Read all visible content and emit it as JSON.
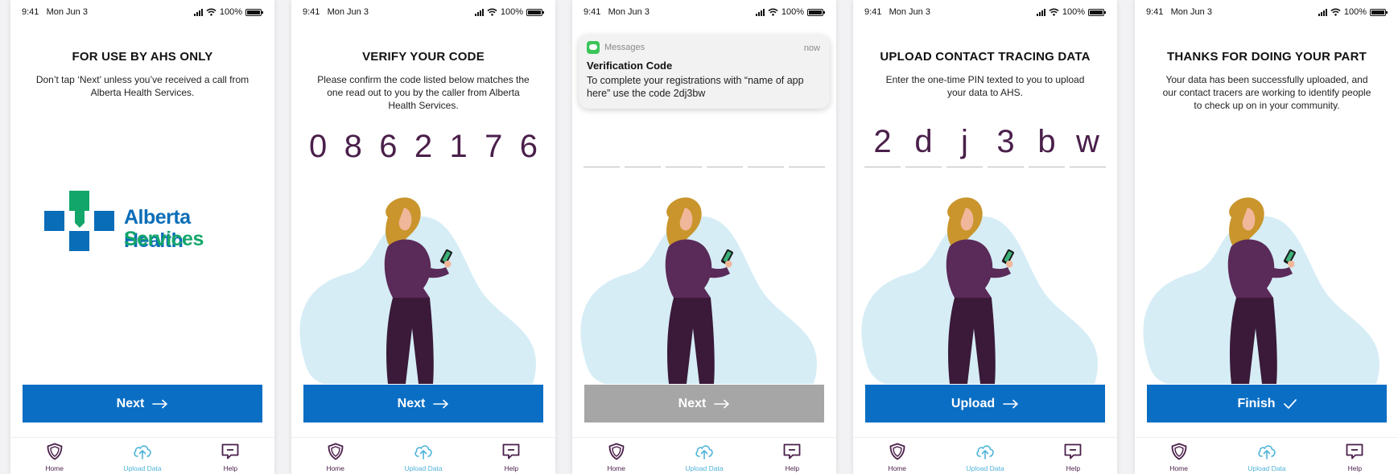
{
  "status": {
    "time": "9:41",
    "date": "Mon Jun 3",
    "battery": "100%"
  },
  "tabs": [
    {
      "label": "Home",
      "icon": "shield-icon"
    },
    {
      "label": "Upload Data",
      "icon": "cloud-upload-icon"
    },
    {
      "label": "Help",
      "icon": "chat-bubble-icon"
    }
  ],
  "screens": [
    {
      "title": "FOR USE BY AHS ONLY",
      "body": "Don’t tap ‘Next’ unless you’ve received a call from Alberta Health Services.",
      "logo": {
        "line1": "Alberta Health",
        "line2": "Services"
      },
      "button": "Next",
      "button_icon": "arrow-right-icon"
    },
    {
      "title": "VERIFY YOUR CODE",
      "body": "Please confirm the code listed below matches the one read out to you by the caller from Alberta Health Services.",
      "code": [
        "0",
        "8",
        "6",
        "2",
        "1",
        "7",
        "6"
      ],
      "button": "Next",
      "button_icon": "arrow-right-icon"
    },
    {
      "notification": {
        "app": "Messages",
        "when": "now",
        "title": "Verification Code",
        "message": "To complete your registrations with “name of app here” use the code 2dj3bw"
      },
      "button": "Next",
      "button_icon": "arrow-right-icon",
      "button_disabled": true
    },
    {
      "title": "UPLOAD CONTACT TRACING DATA",
      "body": "Enter the one-time PIN texted to you to upload your data to AHS.",
      "pin": [
        "2",
        "d",
        "j",
        "3",
        "b",
        "w"
      ],
      "button": "Upload",
      "button_icon": "arrow-right-icon"
    },
    {
      "title": "THANKS FOR DOING YOUR PART",
      "body": "Your data has been successfully uploaded, and our contact tracers are working to identify people to check up on in your community.",
      "button": "Finish",
      "button_icon": "checkmark-icon"
    }
  ],
  "colors": {
    "primary_blue": "#0a6ec4",
    "disabled_grey": "#a6a6a6",
    "plum": "#4a1f4a",
    "active_tab": "#4fb3d9",
    "ahs_blue": "#0a6db8",
    "ahs_green": "#12a66a"
  }
}
